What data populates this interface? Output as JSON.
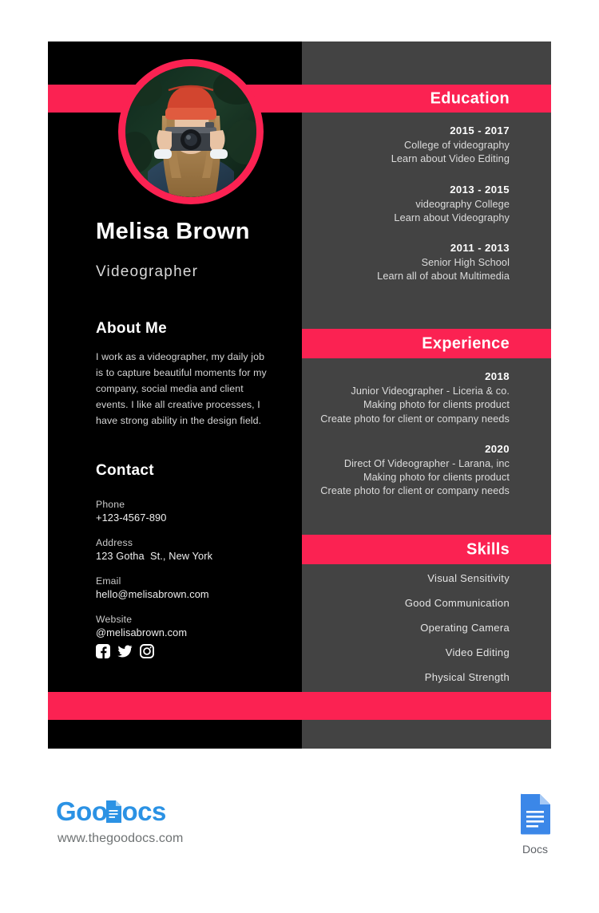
{
  "accent_color": "#fb2252",
  "panel_dark": "#000000",
  "panel_gray": "#434343",
  "profile": {
    "name": "Melisa Brown",
    "role": "Videographer",
    "photo_alt": "woman-with-camera-photo"
  },
  "about": {
    "heading": "About Me",
    "text": "I work as a videographer, my daily job is to capture beautiful moments for my company, social media and client events. I like all creative processes, I have strong ability in the design field."
  },
  "contact": {
    "heading": "Contact",
    "items": [
      {
        "label": "Phone",
        "value": "+123-4567-890"
      },
      {
        "label": "Address",
        "value": "123 Gotha  St., New York"
      },
      {
        "label": "Email",
        "value": "hello@melisabrown.com"
      },
      {
        "label": "Website",
        "value": "@melisabrown.com"
      }
    ]
  },
  "social": [
    {
      "name": "facebook-icon"
    },
    {
      "name": "twitter-icon"
    },
    {
      "name": "instagram-icon"
    }
  ],
  "education": {
    "heading": "Education",
    "entries": [
      {
        "year": "2015 - 2017",
        "lines": [
          "College of videography",
          "Learn about Video Editing"
        ]
      },
      {
        "year": "2013 - 2015",
        "lines": [
          "videography College",
          "Learn about Videography"
        ]
      },
      {
        "year": "2011 - 2013",
        "lines": [
          "Senior High School",
          "Learn all of about Multimedia"
        ]
      }
    ]
  },
  "experience": {
    "heading": "Experience",
    "entries": [
      {
        "year": "2018",
        "lines": [
          "Junior Videographer - Liceria & co.",
          "Making photo for clients product",
          "Create photo for client or company needs"
        ]
      },
      {
        "year": "2020",
        "lines": [
          "Direct Of Videographer - Larana, inc",
          "Making photo for clients product",
          "Create photo for client or company needs"
        ]
      }
    ]
  },
  "skills": {
    "heading": "Skills",
    "items": [
      "Visual Sensitivity",
      "Good Communication",
      "Operating Camera",
      "Video Editing",
      "Physical Strength"
    ]
  },
  "footer": {
    "brand_part1": "Goo",
    "brand_part2": "ocs",
    "url": "www.thegoodocs.com",
    "docs_label": "Docs"
  }
}
